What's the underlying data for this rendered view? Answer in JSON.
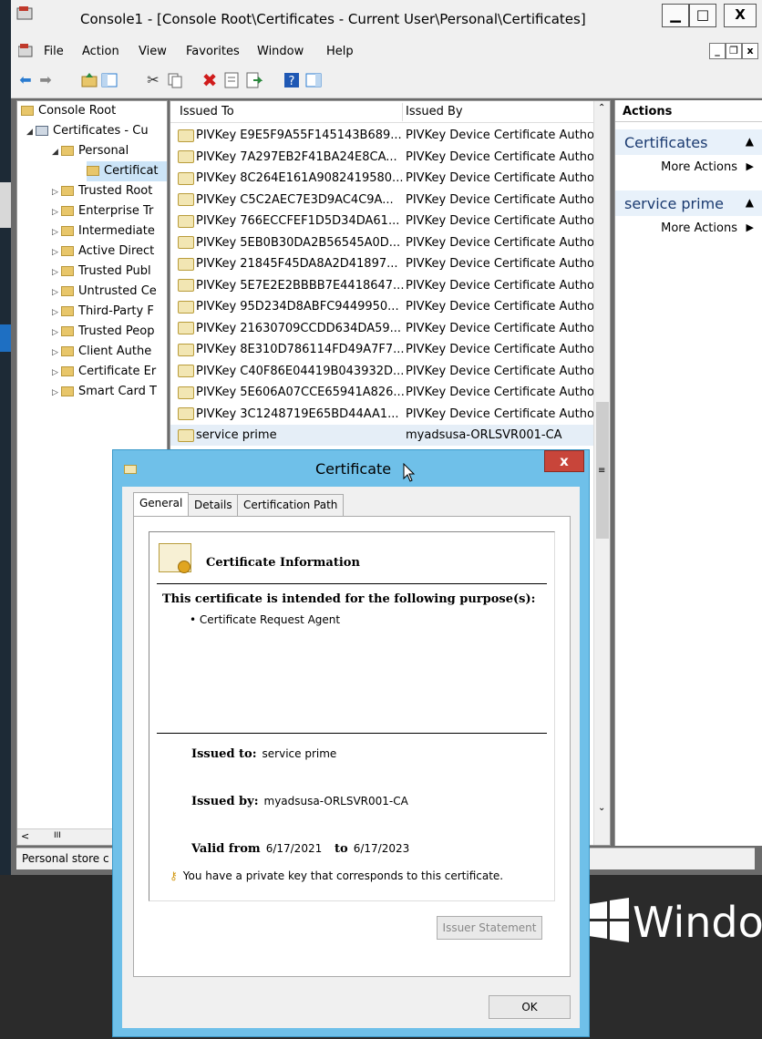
{
  "window": {
    "title": "Console1 - [Console Root\\Certificates - Current User\\Personal\\Certificates]",
    "minimize": "▁",
    "maximize": "□",
    "close": "X"
  },
  "menu": {
    "items": [
      "File",
      "Action",
      "View",
      "Favorites",
      "Window",
      "Help"
    ],
    "mdi_min": "_",
    "mdi_restore": "❐",
    "mdi_close": "x"
  },
  "tree": {
    "items": [
      {
        "label": "Console Root"
      },
      {
        "label": "Certificates - Cu"
      },
      {
        "label": "Personal"
      },
      {
        "label": "Certificat"
      },
      {
        "label": "Trusted Root"
      },
      {
        "label": "Enterprise Tr"
      },
      {
        "label": "Intermediate"
      },
      {
        "label": "Active Direct"
      },
      {
        "label": "Trusted Publ"
      },
      {
        "label": "Untrusted Ce"
      },
      {
        "label": "Third-Party F"
      },
      {
        "label": "Trusted Peop"
      },
      {
        "label": "Client Authe"
      },
      {
        "label": "Certificate Er"
      },
      {
        "label": "Smart Card T"
      }
    ],
    "scroll_glyph": "III"
  },
  "list": {
    "headers": {
      "issued_to": "Issued To",
      "issued_by": "Issued By"
    },
    "rows": [
      {
        "to": "PIVKey E9E5F9A55F145143B689...",
        "by": "PIVKey Device Certificate Authority"
      },
      {
        "to": "PIVKey 7A297EB2F41BA24E8CA...",
        "by": "PIVKey Device Certificate Authority"
      },
      {
        "to": "PIVKey 8C264E161A9082419580...",
        "by": "PIVKey Device Certificate Authority"
      },
      {
        "to": "PIVKey C5C2AEC7E3D9AC4C9A...",
        "by": "PIVKey Device Certificate Authority"
      },
      {
        "to": "PIVKey 766ECCFEF1D5D34DA61...",
        "by": "PIVKey Device Certificate Authority"
      },
      {
        "to": "PIVKey 5EB0B30DA2B56545A0D...",
        "by": "PIVKey Device Certificate Authority"
      },
      {
        "to": "PIVKey 21845F45DA8A2D41897...",
        "by": "PIVKey Device Certificate Authority"
      },
      {
        "to": "PIVKey 5E7E2E2BBBB7E4418647...",
        "by": "PIVKey Device Certificate Authority"
      },
      {
        "to": "PIVKey 95D234D8ABFC9449950...",
        "by": "PIVKey Device Certificate Authority"
      },
      {
        "to": "PIVKey 21630709CCDD634DA59...",
        "by": "PIVKey Device Certificate Authority"
      },
      {
        "to": "PIVKey 8E310D786114FD49A7F7...",
        "by": "PIVKey Device Certificate Authority"
      },
      {
        "to": "PIVKey C40F86E04419B043932D...",
        "by": "PIVKey Device Certificate Authority"
      },
      {
        "to": "PIVKey 5E606A07CCE65941A826...",
        "by": "PIVKey Device Certificate Authority"
      },
      {
        "to": "PIVKey 3C1248719E65BD44AA1...",
        "by": "PIVKey Device Certificate Authority"
      },
      {
        "to": "service prime",
        "by": "myadsusa-ORLSVR001-CA"
      }
    ]
  },
  "actions": {
    "header": "Actions",
    "sections": [
      {
        "title": "Certificates",
        "more": "More Actions"
      },
      {
        "title": "service prime",
        "more": "More Actions"
      }
    ]
  },
  "status": {
    "text": "Personal store c"
  },
  "desktop": {
    "brand": "Window"
  },
  "dialog": {
    "title": "Certificate",
    "close": "x",
    "tabs": [
      "General",
      "Details",
      "Certification Path"
    ],
    "info_title": "Certificate Information",
    "purpose_heading": "This certificate is intended for the following purpose(s):",
    "purposes": [
      "• Certificate Request Agent"
    ],
    "issued_to_label": "Issued to:",
    "issued_to": "service prime",
    "issued_by_label": "Issued by:",
    "issued_by": "myadsusa-ORLSVR001-CA",
    "valid_from_label": "Valid from",
    "valid_from": "6/17/2021",
    "to_label": "to",
    "valid_to": "6/17/2023",
    "private_key_note": "You have a private key that corresponds to this certificate.",
    "issuer_statement": "Issuer Statement",
    "ok": "OK"
  }
}
